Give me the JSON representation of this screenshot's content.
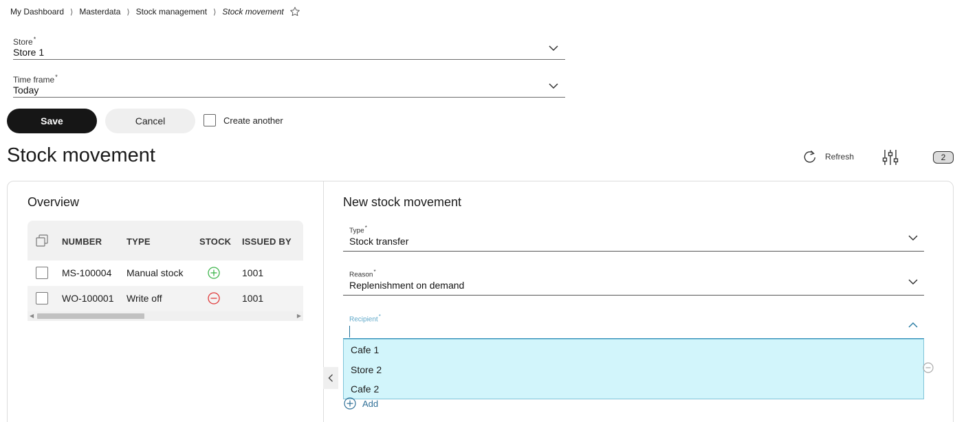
{
  "breadcrumb": {
    "items": [
      "My Dashboard",
      "Masterdata",
      "Stock management"
    ],
    "current": "Stock movement",
    "separator": "⟩"
  },
  "store_field": {
    "label": "Store",
    "required": "*",
    "value": "Store 1"
  },
  "timeframe_field": {
    "label": "Time frame",
    "required": "*",
    "value": "Today"
  },
  "actions": {
    "save_label": "Save",
    "cancel_label": "Cancel",
    "create_another_label": "Create another"
  },
  "page_title": "Stock movement",
  "toolbar": {
    "refresh_label": "Refresh",
    "count_badge": "2"
  },
  "overview": {
    "title": "Overview",
    "columns": [
      "NUMBER",
      "TYPE",
      "STOCK",
      "ISSUED BY"
    ],
    "rows": [
      {
        "number": "MS-100004",
        "type": "Manual stock",
        "stock_icon": "plus-circle-icon",
        "issued_by": "1001"
      },
      {
        "number": "WO-100001",
        "type": "Write off",
        "stock_icon": "minus-circle-icon",
        "issued_by": "1001"
      }
    ]
  },
  "new_movement": {
    "title": "New stock movement",
    "type_field": {
      "label": "Type",
      "required": "*",
      "value": "Stock transfer"
    },
    "reason_field": {
      "label": "Reason",
      "required": "*",
      "value": "Replenishment on demand"
    },
    "recipient_field": {
      "label": "Recipient",
      "required": "*",
      "value": ""
    },
    "recipient_options": [
      "Cafe 1",
      "Store 2",
      "Cafe 2"
    ],
    "add_label": "Add"
  },
  "colors": {
    "primary_button": "#161616",
    "dropdown_bg": "#d2f5fb",
    "focus_blue": "#3d95bd",
    "plus_green": "#3cb44a",
    "minus_red": "#e03838",
    "link_blue": "#2f6f97"
  }
}
